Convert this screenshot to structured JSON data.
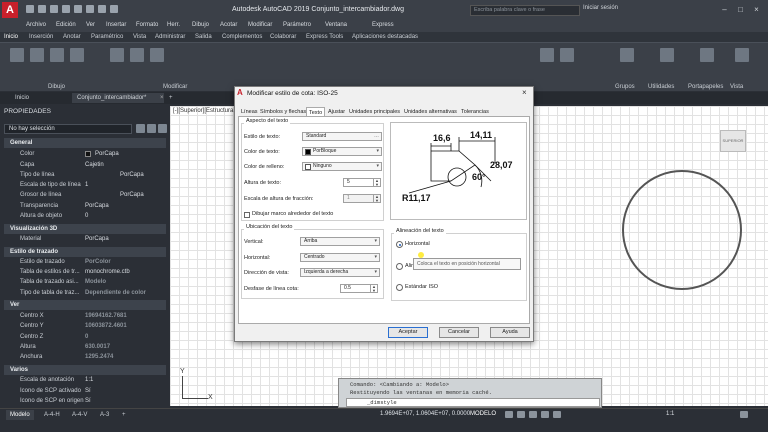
{
  "app": {
    "title": "Autodesk AutoCAD 2019   Conjunto_intercambiador.dwg",
    "search_placeholder": "Escriba palabra clave o frase",
    "login": "Iniciar sesión",
    "logo": "A"
  },
  "menubar": [
    "Archivo",
    "Edición",
    "Ver",
    "Insertar",
    "Formato",
    "Herr.",
    "Dibujo",
    "Acotar",
    "Modificar",
    "Parámetro",
    "Ventana",
    "Express"
  ],
  "ribbon": {
    "tabs": [
      "Inicio",
      "Inserción",
      "Anotar",
      "Paramétrico",
      "Vista",
      "Administrar",
      "Salida",
      "Complementos",
      "Colaborar",
      "Express Tools",
      "Aplicaciones destacadas"
    ],
    "groups": [
      "Dibujo",
      "Modificar",
      "Grupos",
      "Utilidades",
      "Portapapeles",
      "Vista"
    ]
  },
  "doctabs": {
    "start": "Inicio",
    "drawing": "Conjunto_intercambiador*",
    "close": "×",
    "add": "+"
  },
  "properties": {
    "title": "PROPIEDADES",
    "selection": "No hay selección",
    "sections": {
      "general": "General",
      "visual3d": "Visualización 3D",
      "plot": "Estilo de trazado",
      "view": "Ver",
      "misc": "Varios"
    },
    "general": [
      {
        "label": "Color",
        "value": "PorCapa"
      },
      {
        "label": "Capa",
        "value": "Cajetin"
      },
      {
        "label": "Tipo de línea",
        "value": "PorCapa"
      },
      {
        "label": "Escala de tipo de línea",
        "value": "1"
      },
      {
        "label": "Grosor de línea",
        "value": "PorCapa"
      },
      {
        "label": "Transparencia",
        "value": "PorCapa"
      },
      {
        "label": "Altura de objeto",
        "value": "0"
      }
    ],
    "visual3d": [
      {
        "label": "Material",
        "value": "PorCapa"
      }
    ],
    "plot": [
      {
        "label": "Estilo de trazado",
        "value": "PorColor"
      },
      {
        "label": "Tabla de estilos de tr...",
        "value": "monochrome.ctb"
      },
      {
        "label": "Tabla de trazado asi...",
        "value": "Modelo"
      },
      {
        "label": "Tipo de tabla de traz...",
        "value": "Dependiente de color"
      }
    ],
    "view": [
      {
        "label": "Centro X",
        "value": "19694162.7681"
      },
      {
        "label": "Centro Y",
        "value": "10603872.4601"
      },
      {
        "label": "Centro Z",
        "value": "0"
      },
      {
        "label": "Altura",
        "value": "630.0017"
      },
      {
        "label": "Anchura",
        "value": "1295.2474"
      }
    ],
    "misc": [
      {
        "label": "Escala de anotación",
        "value": "1:1"
      },
      {
        "label": "Icono de SCP activado",
        "value": "Sí"
      },
      {
        "label": "Icono de SCP en origen",
        "value": "Sí"
      }
    ]
  },
  "viewport": {
    "label": "[-][Superior][Estructura...",
    "ucs_x": "X",
    "ucs_y": "Y"
  },
  "command": {
    "lines": [
      "Comando:  <Cambiando a: Modelo>",
      "Restituyendo las ventanas en memoria caché."
    ],
    "input": "_dimstyle"
  },
  "statusbar": {
    "layout_tabs": [
      "Modelo",
      "A-4-H",
      "A-4-V",
      "A-3"
    ],
    "coords": "1.9694E+07, 1.0604E+07, 0.0000",
    "model": "MODELO",
    "scale": "1:1"
  },
  "dialog": {
    "title": "Modificar estilo de cota: ISO-25",
    "close": "×",
    "tabs": [
      "Líneas",
      "Símbolos y flechas",
      "Texto",
      "Ajustar",
      "Unidades principales",
      "Unidades alternativas",
      "Tolerancias"
    ],
    "active_tab": "Texto",
    "appearance": {
      "title": "Aspecto del texto",
      "text_style": {
        "label": "Estilo de texto:",
        "value": "Standard"
      },
      "text_color": {
        "label": "Color de texto:",
        "value": "PorBloque",
        "swatch": "#000000"
      },
      "fill_color": {
        "label": "Color de relleno:",
        "value": "Ninguno",
        "swatch": "#ffffff"
      },
      "text_height": {
        "label": "Altura de texto:",
        "value": "5"
      },
      "fraction_scale": {
        "label": "Escala de altura de fracción:",
        "value": "1"
      },
      "frame": {
        "label": "Dibujar marco alrededor del texto",
        "checked": false
      }
    },
    "placement": {
      "title": "Ubicación del texto",
      "vertical": {
        "label": "Vertical:",
        "value": "Arriba"
      },
      "horizontal": {
        "label": "Horizontal:",
        "value": "Centrado"
      },
      "view_direction": {
        "label": "Dirección de vista:",
        "value": "Izquierda a derecha"
      },
      "offset": {
        "label": "Desfase de línea cota:",
        "value": "0.5"
      }
    },
    "alignment": {
      "title": "Alineación del texto",
      "options": [
        "Horizontal",
        "Alineado con línea de cota",
        "Estándar ISO"
      ],
      "selected": "Horizontal",
      "tooltip": "Coloca el texto en posición horizontal"
    },
    "preview": {
      "dims": [
        "16,6",
        "14,11",
        "28,07",
        "60°",
        "R11,17"
      ]
    },
    "buttons": {
      "ok": "Aceptar",
      "cancel": "Cancelar",
      "help": "Ayuda"
    }
  },
  "viewcube": {
    "label": "SUPERIOR"
  }
}
